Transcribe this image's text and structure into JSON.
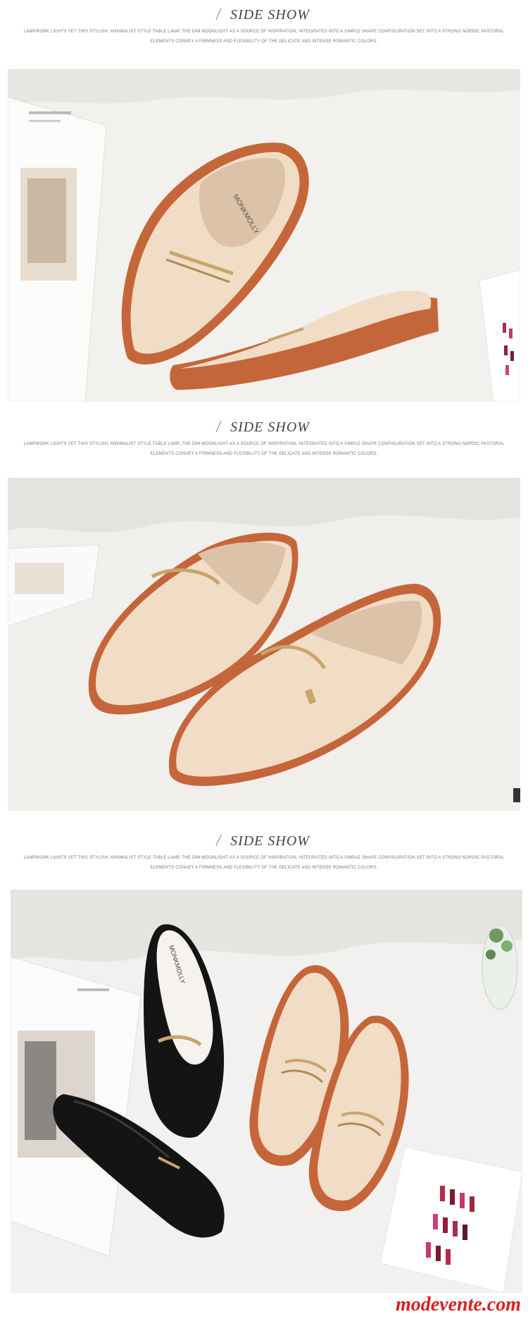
{
  "sections": [
    {
      "title": "SIDE SHOW",
      "line1": "LAMPWORK LIGHTS YET THIS STYLISH, MINIMALIST STYLE TABLE LAMP, THE DIM MOONLIGHT AS A SOURCE OF INSPIRATION, INTEGRATED INTO A SIMPLE SHAPE CONFIGURATION SET INTO A STRONG NORDIC PASTORAL",
      "line2": "ELEMENTS CONVEY A FIRMNESS AND FLEXIBILITY OF THE DELICATE AND INTENSE ROMANTIC COLORS."
    },
    {
      "title": "SIDE SHOW",
      "line1": "LAMPWORK LIGHTS YET THIS STYLISH, MINIMALIST STYLE TABLE LAMP, THE DIM MOONLIGHT AS A SOURCE OF INSPIRATION, INTEGRATED INTO A SIMPLE SHAPE CONFIGURATION SET INTO A STRONG NORDIC PASTORAL",
      "line2": "ELEMENTS CONVEY A FIRMNESS AND FLEXIBILITY OF THE DELICATE AND INTENSE ROMANTIC COLORS."
    },
    {
      "title": "SIDE SHOW",
      "line1": "LAMPWORK LIGHTS YET THIS STYLISH, MINIMALIST STYLE TABLE LAMP, THE DIM MOONLIGHT AS A SOURCE OF INSPIRATION, INTEGRATED INTO A SIMPLE SHAPE CONFIGURATION SET INTO A STRONG NORDIC PASTORAL",
      "line2": "ELEMENTS CONVEY A FIRMNESS AND FLEXIBILITY OF THE DELICATE AND INTENSE ROMANTIC COLORS."
    }
  ],
  "shoe_brand_text": "MONKMOLLY",
  "watermark": "modevente.com",
  "colors": {
    "cream": "#f1dcc6",
    "sole": "#c5663a",
    "black_leather": "#141414",
    "gold": "#c9a56a",
    "background": "#f3f1ee",
    "watermark": "#d9201f"
  }
}
